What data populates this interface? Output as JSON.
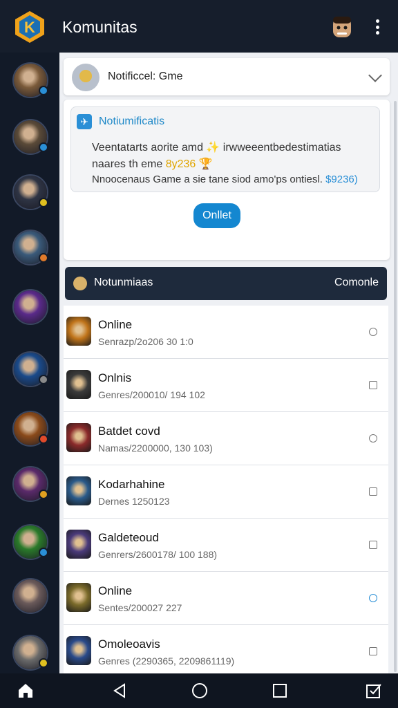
{
  "app": {
    "title": "Komunitas",
    "accent": "#1487d0"
  },
  "sidebar": {
    "items": [
      {
        "name": "warrior-avatar",
        "color": "#7a5a3a",
        "badge": "#2a8fd6"
      },
      {
        "name": "gunner-avatar",
        "color": "#5a4a38",
        "badge": "#2a8fd6"
      },
      {
        "name": "dark-knight-avatar",
        "color": "#2e3444",
        "badge": "#e0c020"
      },
      {
        "name": "mage-avatar",
        "color": "#3a5a7a",
        "badge": "#e07a2a"
      },
      {
        "name": "purple-flame-avatar",
        "color": "#5a2a8a",
        "badge": ""
      },
      {
        "name": "blue-ring-avatar",
        "color": "#1a4a8a",
        "badge": "#8a8a8a"
      },
      {
        "name": "fire-warrior-avatar",
        "color": "#8a4a1a",
        "badge": "#e04a2a"
      },
      {
        "name": "shadow-avatar",
        "color": "#5a2a6a",
        "badge": "#e0a020"
      },
      {
        "name": "green-beast-avatar",
        "color": "#2a7a2a",
        "badge": "#2a8fd6"
      },
      {
        "name": "armored-avatar",
        "color": "#6a5a5a",
        "badge": ""
      },
      {
        "name": "mech-avatar",
        "color": "#6a6a6a",
        "badge": "#e0c020"
      }
    ]
  },
  "notification_header": {
    "title": "Notificcel: Gme"
  },
  "notification_card": {
    "title": "Notiumificatis",
    "line1": "Veentatarts aorite amd ✨ irwweeentbedestimatias",
    "line2_prefix": "naares th eme ",
    "line2_highlight": "8y236 🏆",
    "line3_prefix": "Nnoocenaus Game a sie tane siod amo'ps ontiesl. ",
    "line3_highlight": "$9236)",
    "button_label": "Onllet"
  },
  "section": {
    "title": "Notunmiaas",
    "right_label": "Comonle"
  },
  "games": [
    {
      "title": "Online",
      "subtitle": "Senrazp/2o206 30 1:0",
      "action": "search",
      "color": "#c0741a"
    },
    {
      "title": "Onlnis",
      "subtitle": "Genres/200010/ 194 102",
      "action": "square",
      "color": "#3a3a3a"
    },
    {
      "title": "Batdet covd",
      "subtitle": "Namas/2200000, 130 103)",
      "action": "circle",
      "color": "#8a2a2a"
    },
    {
      "title": "Kodarhahine",
      "subtitle": "Dernes 1250123",
      "action": "square",
      "color": "#2a5a8a"
    },
    {
      "title": "Galdeteoud",
      "subtitle": "Genrers/2600178/ 100 188)",
      "action": "square",
      "color": "#4a3a7a"
    },
    {
      "title": "Online",
      "subtitle": "Sentes/200027 227",
      "action": "timer",
      "color": "#7a6a2a"
    },
    {
      "title": "Omoleoavis",
      "subtitle": "Genres (2290365, 2209861119)",
      "action": "square",
      "color": "#2a4a8a"
    }
  ],
  "bottom_nav": [
    "home-icon",
    "back-icon",
    "circle-home-icon",
    "recent-apps-icon",
    "checkbox-icon"
  ]
}
